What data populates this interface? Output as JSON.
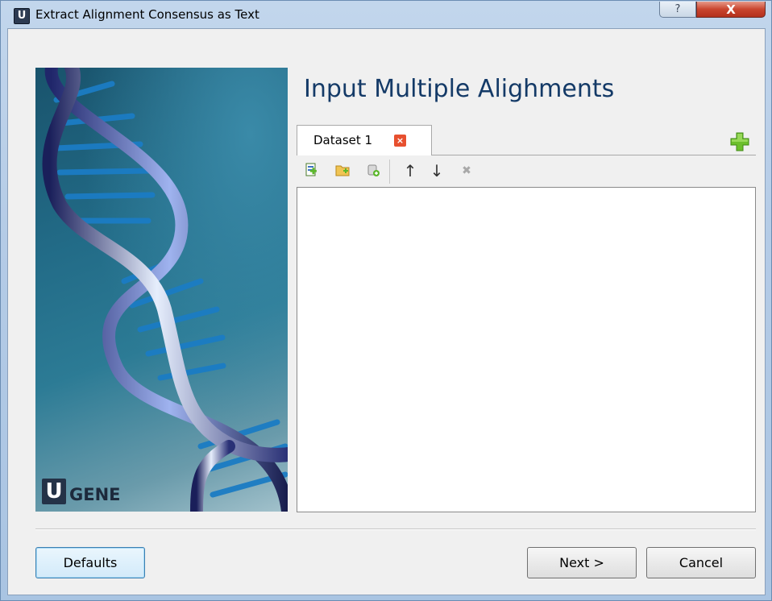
{
  "window": {
    "title": "Extract Alignment Consensus as Text",
    "app_icon_letter": "U",
    "help_button_glyph": "?",
    "close_button_glyph": "X"
  },
  "banner": {
    "logo_letter": "U",
    "logo_text": "GENE"
  },
  "page": {
    "title": "Input Multiple Alighments"
  },
  "tabs": [
    {
      "label": "Dataset 1",
      "close_glyph": "×"
    }
  ],
  "toolbar": {
    "add_file_icon": "add-file-icon",
    "add_folder_icon": "add-folder-icon",
    "add_from_db_icon": "add-from-db-icon",
    "move_up_glyph": "↑",
    "move_down_glyph": "↓",
    "remove_glyph": "✖"
  },
  "buttons": {
    "defaults": "Defaults",
    "next": "Next >",
    "cancel": "Cancel"
  },
  "colors": {
    "title_text": "#143a67",
    "add_dataset_green": "#6cbf2c",
    "tab_close_red": "#e7502f"
  }
}
